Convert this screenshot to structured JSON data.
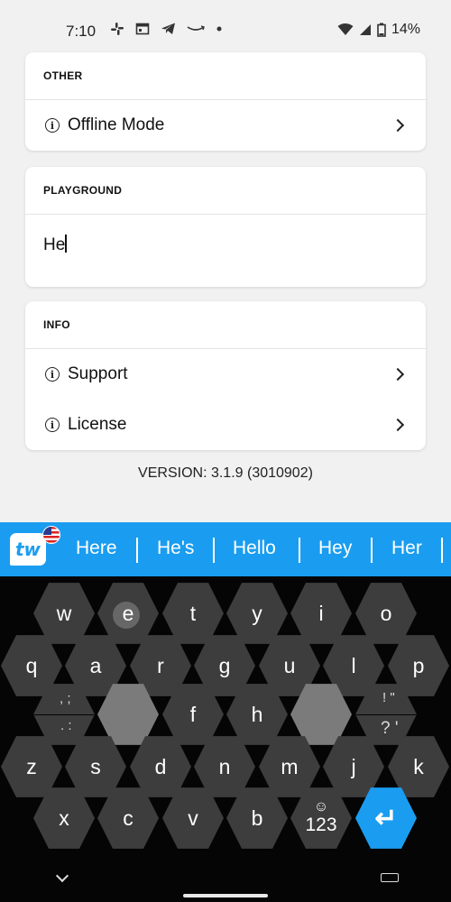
{
  "status": {
    "time": "7:10",
    "battery": "14%"
  },
  "sections": {
    "other": {
      "header": "OTHER",
      "items": [
        {
          "label": "Offline Mode"
        }
      ]
    },
    "playground": {
      "header": "PLAYGROUND",
      "input_value": "He"
    },
    "info": {
      "header": "INFO",
      "items": [
        {
          "label": "Support"
        },
        {
          "label": "License"
        }
      ]
    }
  },
  "version": "VERSION: 3.1.9 (3010902)",
  "suggestions": [
    "Here",
    "He's",
    "Hello",
    "Hey",
    "Her"
  ],
  "keyboard": {
    "row1": [
      "w",
      "e",
      "t",
      "y",
      "i",
      "o"
    ],
    "row2": [
      "q",
      "a",
      "r",
      "g",
      "u",
      "l",
      "p"
    ],
    "row3": [
      "f",
      "h"
    ],
    "row4": [
      "z",
      "s",
      "d",
      "n",
      "m",
      "j",
      "k"
    ],
    "row5": [
      "x",
      "c",
      "v",
      "b"
    ],
    "sym_left_top": ", ;",
    "sym_left_bottom": ". :",
    "sym_right_top": "! \"",
    "sym_right_bottom": "? '",
    "numbers_label": "123",
    "emoji_glyph": "☺",
    "enter_glyph": "↵"
  },
  "colors": {
    "accent": "#1a9df0",
    "key": "#3d3d3d",
    "key_light": "#7b7b7b"
  }
}
